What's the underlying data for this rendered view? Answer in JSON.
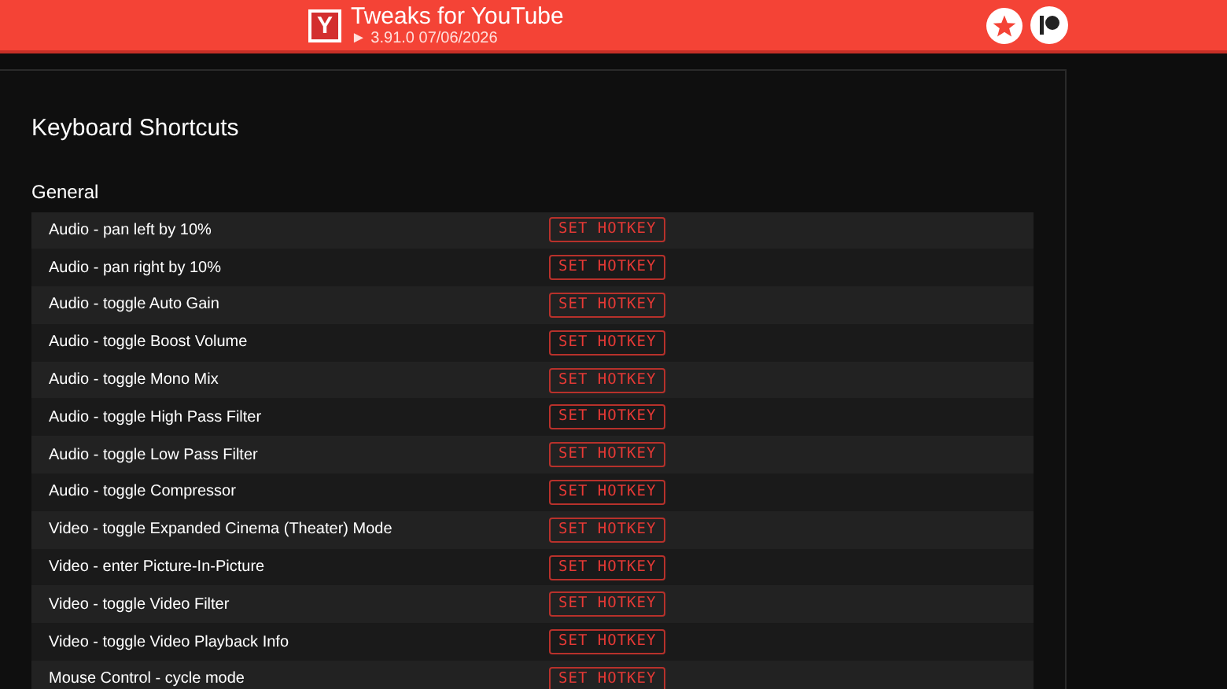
{
  "header": {
    "logo": "Y",
    "title": "Tweaks for YouTube",
    "version": "► 3.91.0 07/06/2026"
  },
  "panel": {
    "title": "Keyboard Shortcuts",
    "section": "General",
    "shortcuts": [
      {
        "label": "Audio - pan left by 10%",
        "button": "SET HOTKEY"
      },
      {
        "label": "Audio - pan right by 10%",
        "button": "SET HOTKEY"
      },
      {
        "label": "Audio - toggle Auto Gain",
        "button": "SET HOTKEY"
      },
      {
        "label": "Audio - toggle Boost Volume",
        "button": "SET HOTKEY"
      },
      {
        "label": "Audio - toggle Mono Mix",
        "button": "SET HOTKEY"
      },
      {
        "label": "Audio - toggle High Pass Filter",
        "button": "SET HOTKEY"
      },
      {
        "label": "Audio - toggle Low Pass Filter",
        "button": "SET HOTKEY"
      },
      {
        "label": "Audio - toggle Compressor",
        "button": "SET HOTKEY"
      },
      {
        "label": "Video - toggle Expanded Cinema (Theater) Mode",
        "button": "SET HOTKEY"
      },
      {
        "label": "Video - enter Picture-In-Picture",
        "button": "SET HOTKEY"
      },
      {
        "label": "Video - toggle Video Filter",
        "button": "SET HOTKEY"
      },
      {
        "label": "Video - toggle Video Playback Info",
        "button": "SET HOTKEY"
      },
      {
        "label": "Mouse Control - cycle mode",
        "button": "SET HOTKEY"
      }
    ]
  }
}
